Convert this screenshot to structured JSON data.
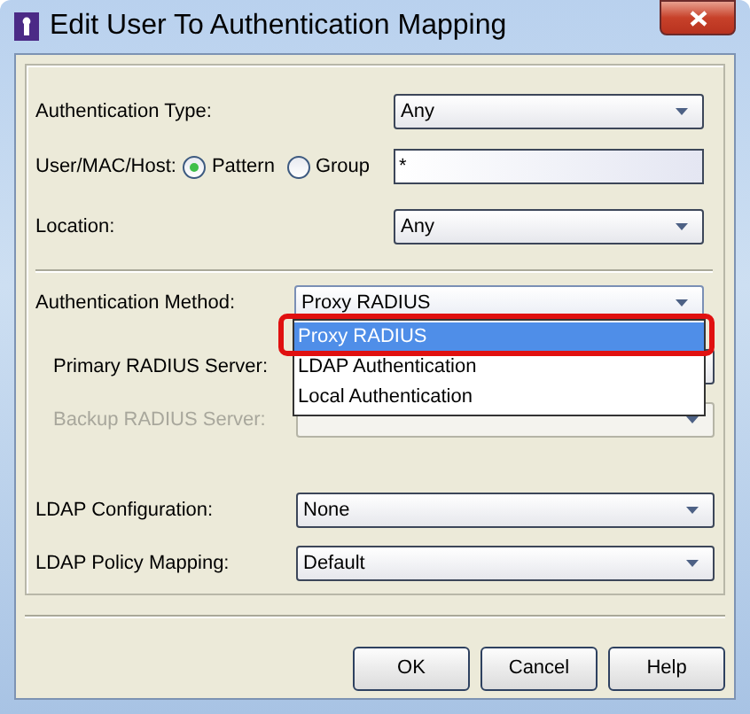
{
  "window": {
    "title": "Edit User To Authentication Mapping"
  },
  "authentication_type": {
    "label": "Authentication Type:",
    "value": "Any"
  },
  "user_mac_host": {
    "label": "User/MAC/Host:",
    "value": "*",
    "options": [
      {
        "label": "Pattern",
        "selected": true
      },
      {
        "label": "Group",
        "selected": false
      }
    ]
  },
  "location": {
    "label": "Location:",
    "value": "Any"
  },
  "authentication_method": {
    "label": "Authentication Method:",
    "value": "Proxy RADIUS",
    "expanded": true,
    "options": [
      {
        "label": "Proxy RADIUS",
        "selected": true
      },
      {
        "label": "LDAP Authentication",
        "selected": false
      },
      {
        "label": "Local Authentication",
        "selected": false
      }
    ]
  },
  "primary_radius_server": {
    "label": "Primary RADIUS Server:"
  },
  "backup_radius_server": {
    "label": "Backup RADIUS Server:",
    "disabled": true
  },
  "ldap_configuration": {
    "label": "LDAP Configuration:",
    "value": "None"
  },
  "ldap_policy_mapping": {
    "label": "LDAP Policy Mapping:",
    "value": "Default"
  },
  "buttons": [
    "OK",
    "Cancel",
    "Help"
  ]
}
